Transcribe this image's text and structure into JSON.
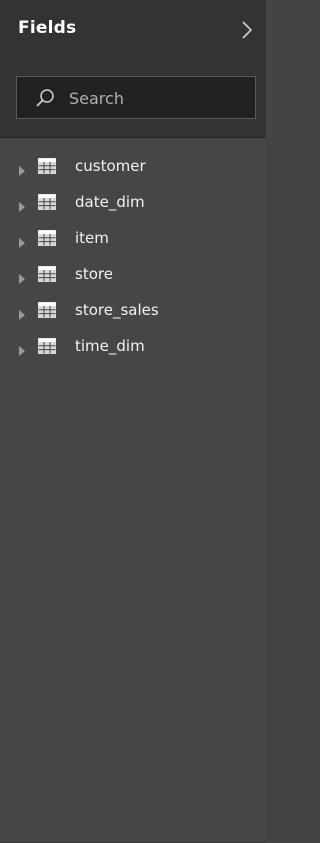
{
  "pane": {
    "title": "Fields",
    "collapse_icon": "chevron-right-icon"
  },
  "search": {
    "placeholder": "Search",
    "icon": "search-icon",
    "value": ""
  },
  "tables": [
    {
      "name": "customer",
      "icon": "table-icon"
    },
    {
      "name": "date_dim",
      "icon": "table-icon"
    },
    {
      "name": "item",
      "icon": "table-icon"
    },
    {
      "name": "store",
      "icon": "table-icon"
    },
    {
      "name": "store_sales",
      "icon": "table-icon"
    },
    {
      "name": "time_dim",
      "icon": "table-icon"
    }
  ],
  "colors": {
    "header_bg": "#333333",
    "list_bg": "#464646",
    "search_bg": "#222222",
    "text": "#ffffff"
  }
}
